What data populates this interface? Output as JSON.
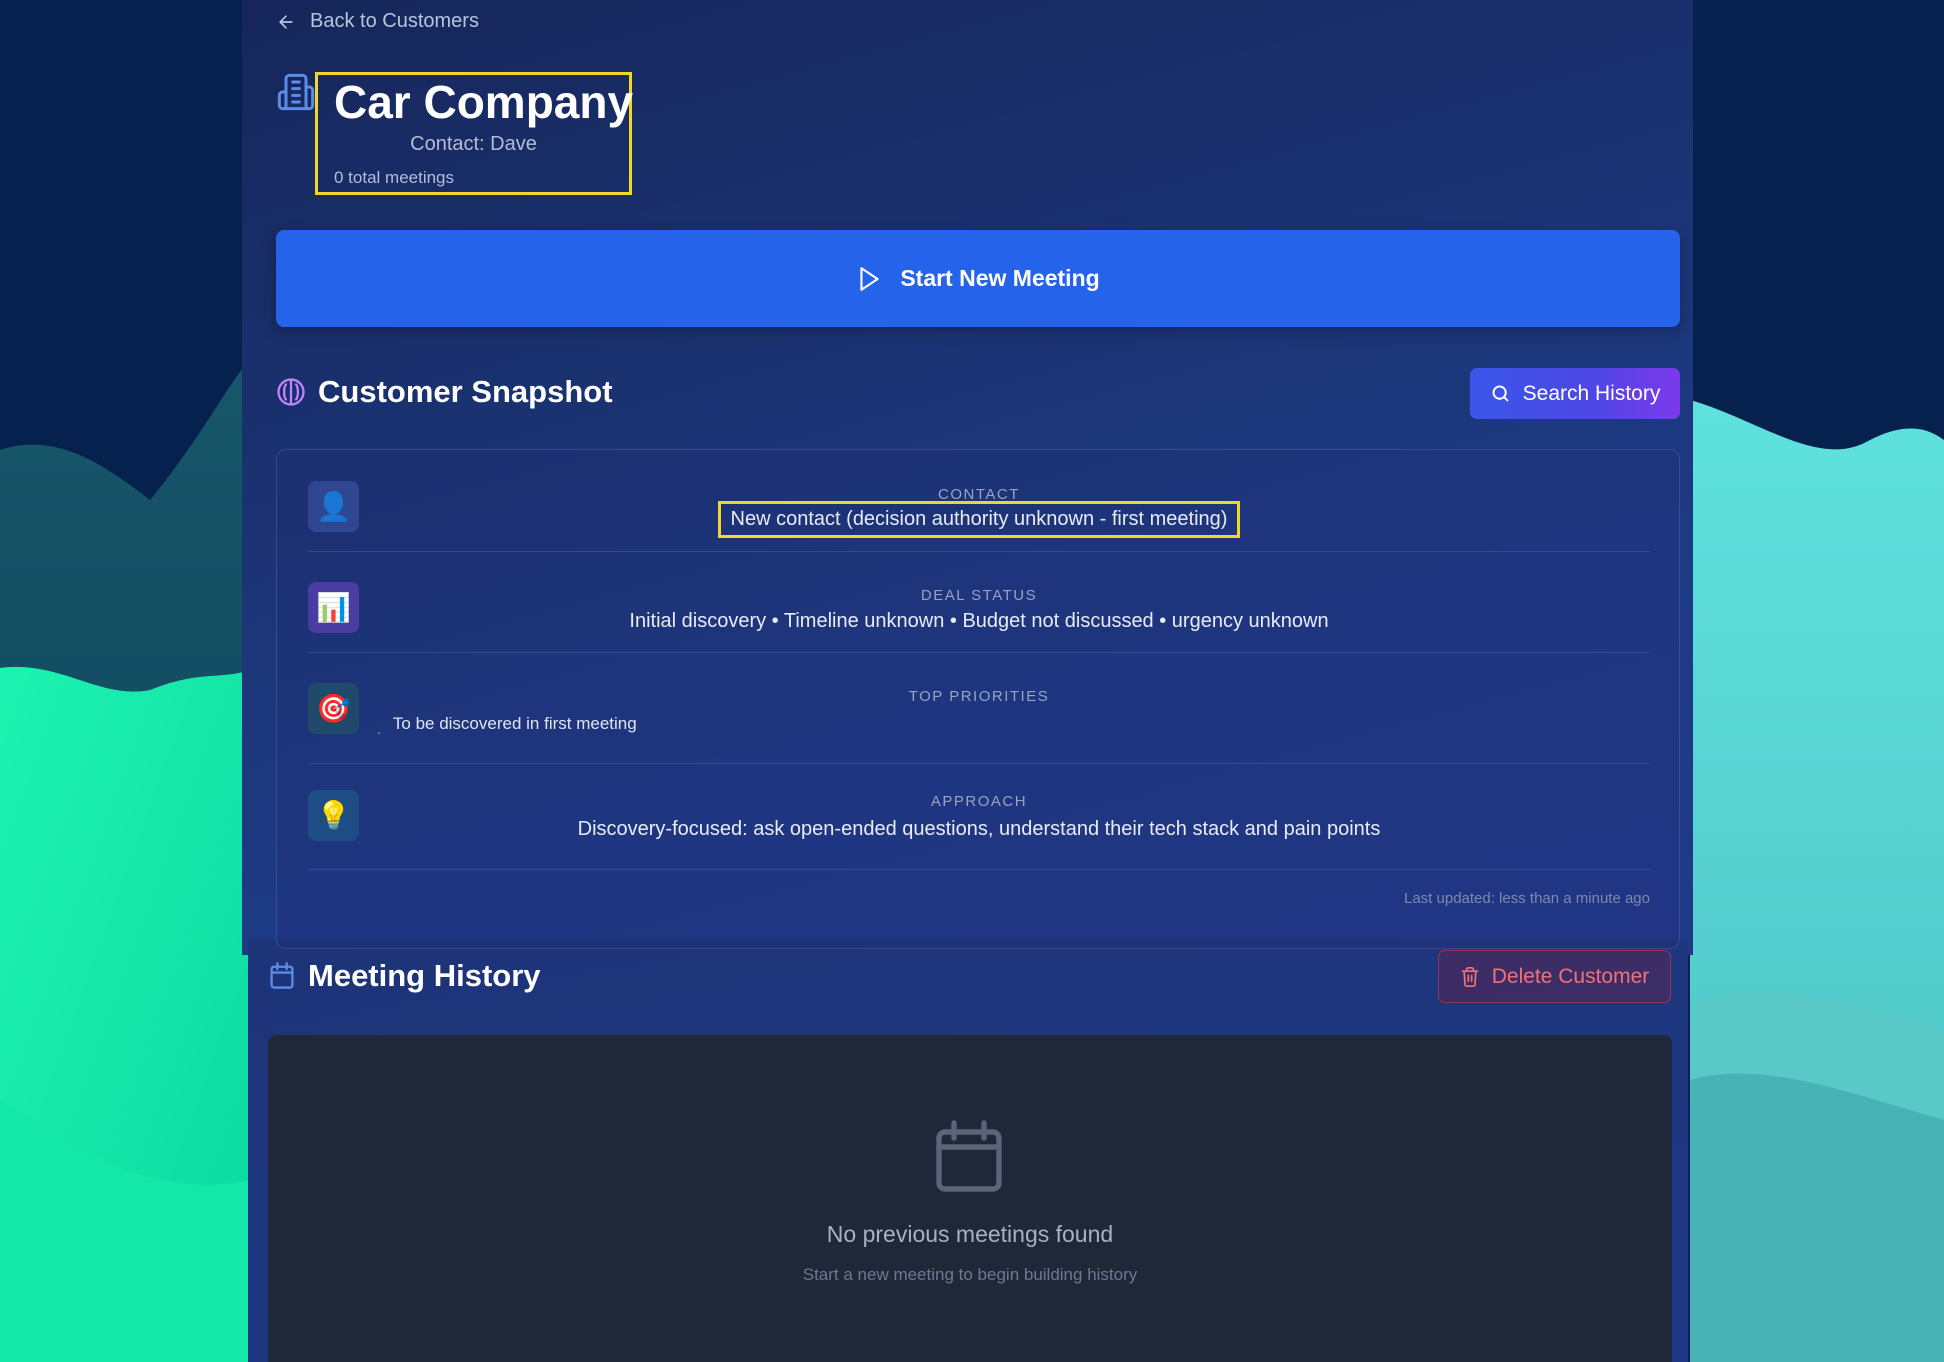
{
  "nav": {
    "back_label": "Back to Customers"
  },
  "customer": {
    "name": "Car Company",
    "contact": "Contact: Dave",
    "meetings": "0 total meetings"
  },
  "actions": {
    "start_meeting": "Start New Meeting",
    "search_history": "Search History",
    "delete_customer": "Delete Customer"
  },
  "snapshot": {
    "title": "Customer Snapshot",
    "contact": {
      "label": "CONTACT",
      "value": "New contact (decision authority unknown - first meeting)",
      "icon": "👤"
    },
    "deal_status": {
      "label": "DEAL STATUS",
      "value": "Initial discovery • Timeline unknown • Budget not discussed • urgency unknown",
      "icon": "📊"
    },
    "priorities": {
      "label": "TOP PRIORITIES",
      "items": [
        "To be discovered in first meeting"
      ],
      "icon": "🎯"
    },
    "approach": {
      "label": "APPROACH",
      "value": "Discovery-focused: ask open-ended questions, understand their tech stack and pain points",
      "icon": "💡"
    },
    "last_updated": "Last updated: less than a minute ago"
  },
  "history": {
    "title": "Meeting History",
    "empty_title": "No previous meetings found",
    "empty_subtitle": "Start a new meeting to begin building history"
  },
  "colors": {
    "accent": "#2563eb",
    "highlight": "#f1d72c",
    "danger": "#f07178",
    "panel": "#1c3577"
  }
}
